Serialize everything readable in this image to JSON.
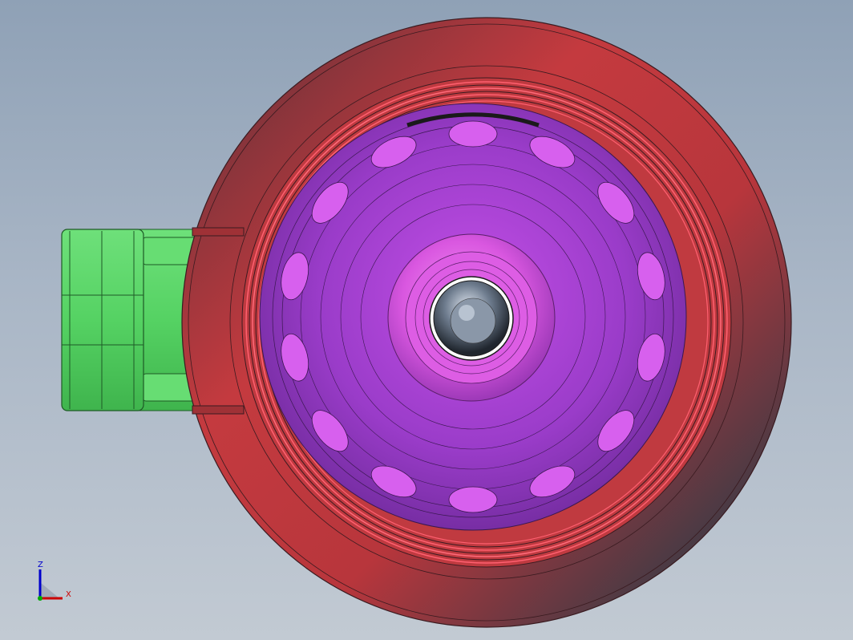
{
  "viewport": {
    "background_top": "#8fa1b6",
    "background_bottom": "#c2cad3"
  },
  "model": {
    "parts": [
      {
        "name": "outer-housing",
        "color": "#c23a3e"
      },
      {
        "name": "inner-rotor",
        "color": "#a43fd3"
      },
      {
        "name": "center-hub",
        "color": "#e060e6"
      },
      {
        "name": "shaft-tip",
        "color": "#7a8898"
      },
      {
        "name": "side-bracket",
        "color": "#5fd86b"
      }
    ]
  },
  "triad": {
    "z_label": "Z",
    "x_label": "X",
    "z_color": "#0000cc",
    "x_color": "#cc0000",
    "y_color": "#00aa00"
  }
}
